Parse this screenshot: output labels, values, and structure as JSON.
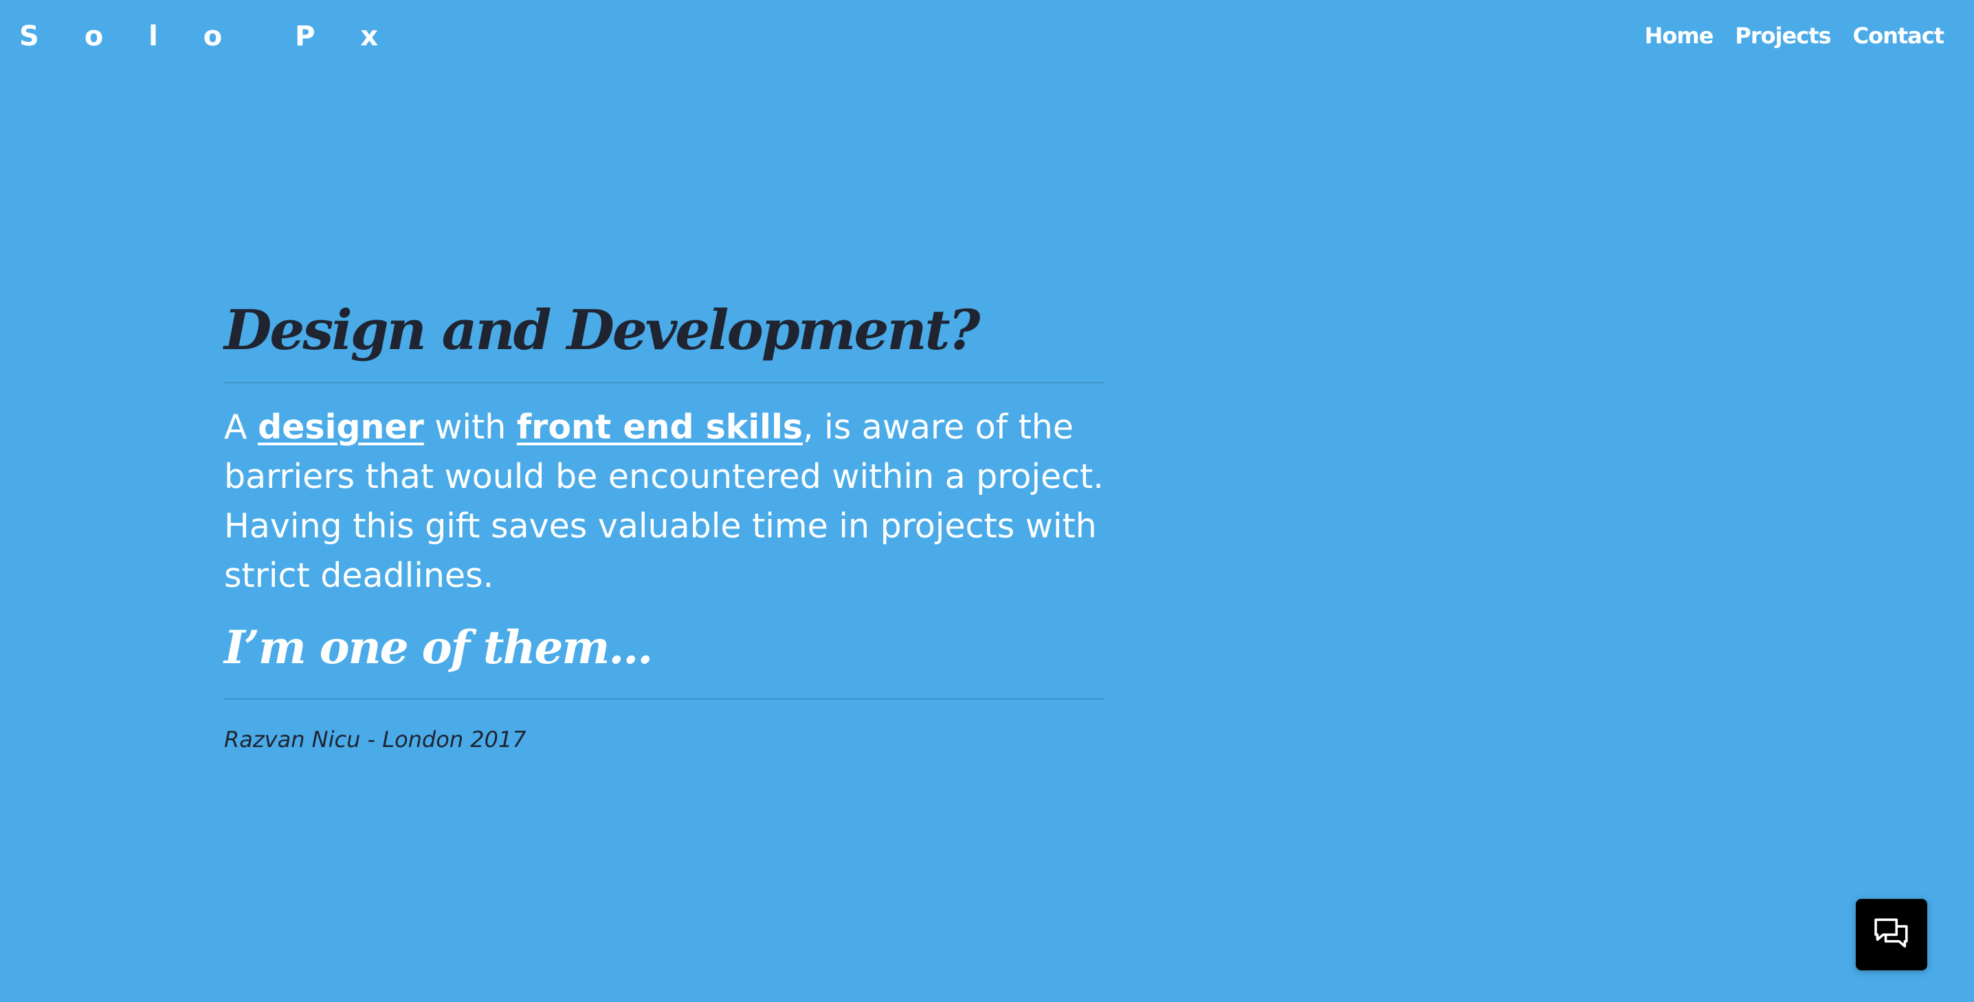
{
  "header": {
    "logo": "S o l o  P x",
    "nav": [
      {
        "label": "Home"
      },
      {
        "label": "Projects"
      },
      {
        "label": "Contact"
      }
    ]
  },
  "main": {
    "headline": "Design and Development?",
    "paragraph": {
      "prefix": "A ",
      "link_designer": "designer",
      "middle": " with ",
      "link_skills": "front end skills",
      "suffix": ", is aware of the barriers that would be encountered within a project. Having this gift saves valuable time in projects with strict deadlines."
    },
    "subheading": "I’m one of them...",
    "signature": "Razvan Nicu - London 2017"
  },
  "chat_widget": {
    "icon": "chat-icon"
  },
  "colors": {
    "background": "#4aabe8",
    "heading_dark": "#1f2430",
    "text_light": "#ffffff",
    "divider": "#3f93c9",
    "chat_button": "#000000"
  }
}
